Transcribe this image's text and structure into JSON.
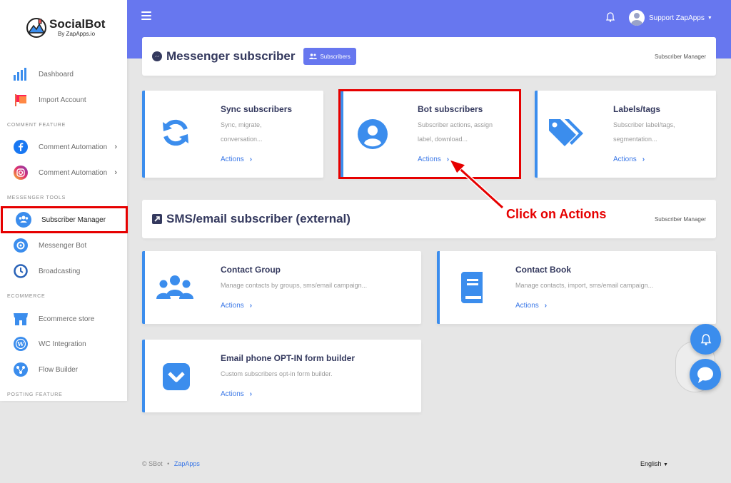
{
  "brand": {
    "name": "SocialBot",
    "sub": "By ZapApps.io"
  },
  "sidebar": {
    "items": [
      {
        "label": "Dashboard"
      },
      {
        "label": "Import Account"
      },
      {
        "label": "Comment Automation"
      },
      {
        "label": "Comment Automation"
      },
      {
        "label": "Subscriber Manager"
      },
      {
        "label": "Messenger Bot"
      },
      {
        "label": "Broadcasting"
      },
      {
        "label": "Ecommerce store"
      },
      {
        "label": "WC Integration"
      },
      {
        "label": "Flow Builder"
      }
    ],
    "headers": [
      "COMMENT FEATURE",
      "MESSENGER TOOLS",
      "ECOMMERCE",
      "POSTING FEATURE"
    ]
  },
  "topbar": {
    "user_name": "Support ZapApps"
  },
  "messenger": {
    "title": "Messenger subscriber",
    "button": "Subscribers",
    "crumb": "Subscriber Manager",
    "cards": [
      {
        "title": "Sync subscribers",
        "desc1": "Sync, migrate,",
        "desc2": "conversation...",
        "action": "Actions"
      },
      {
        "title": "Bot subscribers",
        "desc1": "Subscriber actions, assign",
        "desc2": "label, download...",
        "action": "Actions"
      },
      {
        "title": "Labels/tags",
        "desc1": "Subscriber label/tags,",
        "desc2": "segmentation...",
        "action": "Actions"
      }
    ]
  },
  "external": {
    "title": "SMS/email subscriber (external)",
    "crumb": "Subscriber Manager",
    "cards": [
      {
        "title": "Contact Group",
        "desc": "Manage contacts by groups, sms/email campaign...",
        "action": "Actions"
      },
      {
        "title": "Contact Book",
        "desc": "Manage contacts, import, sms/email campaign...",
        "action": "Actions"
      },
      {
        "title": "Email phone OPT-IN form builder",
        "desc": "Custom subscribers opt-in form builder.",
        "action": "Actions"
      }
    ]
  },
  "annotation": {
    "callout": "Click on Actions"
  },
  "footer": {
    "copyright": "© SBot",
    "link": "ZapApps",
    "language": "English"
  },
  "colors": {
    "primary": "#6777ef",
    "accent": "#3b8ded",
    "highlight": "#e60000"
  }
}
